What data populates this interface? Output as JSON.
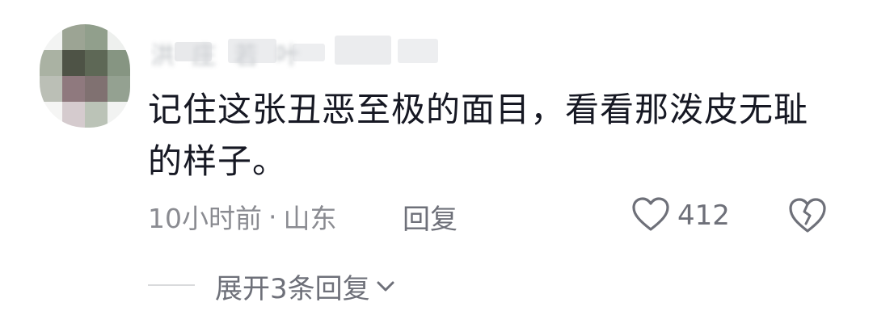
{
  "comment": {
    "username_obscured": "洪 庄 若 叶",
    "text": "记住这张丑恶至极的面目，看看那泼皮无耻的样子。",
    "time": "10小时前",
    "separator": "·",
    "location": "山东",
    "reply_label": "回复",
    "like_count": "412",
    "expand_label": "展开3条回复"
  },
  "icons": {
    "like": "heart-outline-icon",
    "dislike": "broken-heart-icon",
    "expand": "chevron-down-icon"
  },
  "colors": {
    "text_primary": "#161823",
    "text_secondary": "#8a8b91",
    "text_action": "#6e7079"
  }
}
